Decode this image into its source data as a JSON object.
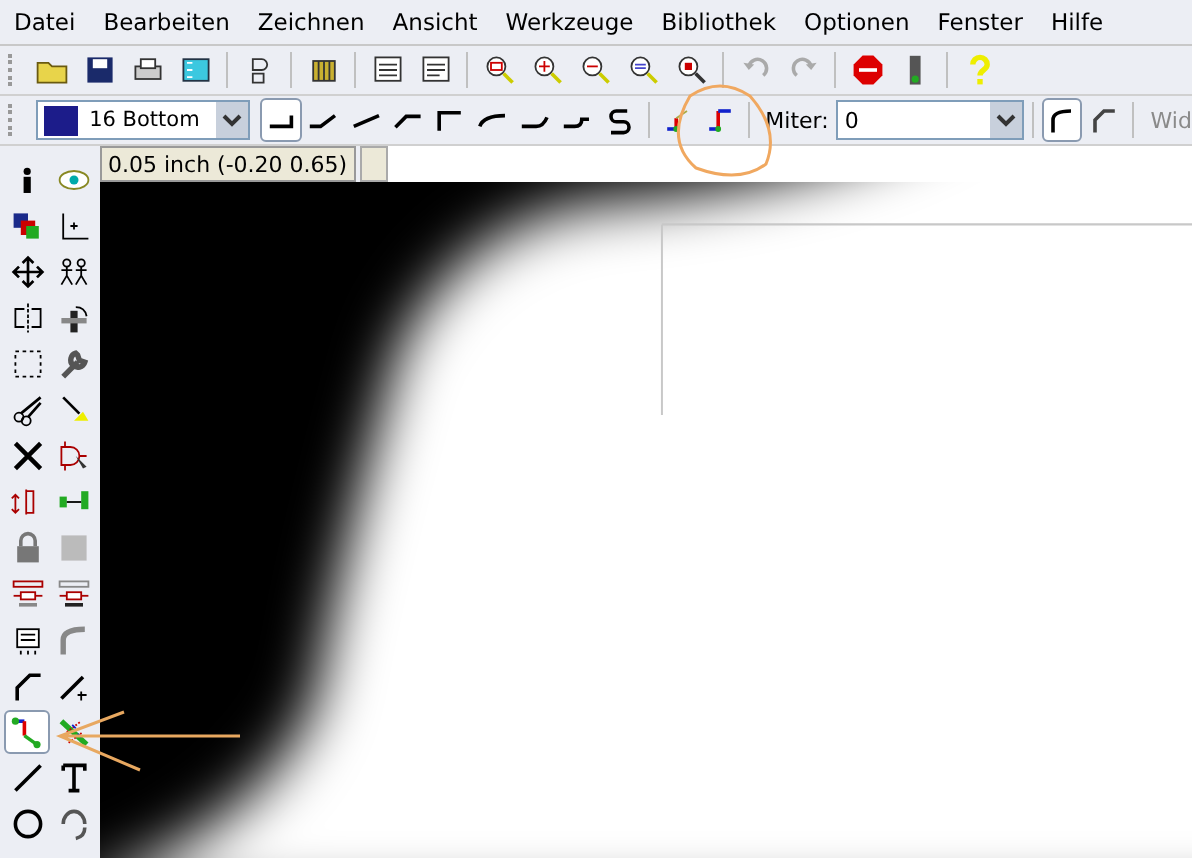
{
  "menu": [
    "Datei",
    "Bearbeiten",
    "Zeichnen",
    "Ansicht",
    "Werkzeuge",
    "Bibliothek",
    "Optionen",
    "Fenster",
    "Hilfe"
  ],
  "toolbar": [
    {
      "kind": "open"
    },
    {
      "kind": "save"
    },
    {
      "kind": "print"
    },
    {
      "kind": "cam"
    },
    {
      "kind": "sep"
    },
    {
      "kind": "schematic"
    },
    {
      "kind": "sep"
    },
    {
      "kind": "library"
    },
    {
      "kind": "sep"
    },
    {
      "kind": "script"
    },
    {
      "kind": "ulp"
    },
    {
      "kind": "sep"
    },
    {
      "kind": "zoomfit"
    },
    {
      "kind": "zoomin"
    },
    {
      "kind": "zoomout"
    },
    {
      "kind": "redraw"
    },
    {
      "kind": "zoomselect"
    },
    {
      "kind": "sep"
    },
    {
      "kind": "undo"
    },
    {
      "kind": "redo"
    },
    {
      "kind": "sep"
    },
    {
      "kind": "stop"
    },
    {
      "kind": "go"
    },
    {
      "kind": "sep"
    },
    {
      "kind": "help"
    }
  ],
  "params": {
    "layer": {
      "color": "#1c1c8a",
      "value": "16 Bottom"
    },
    "bends": [
      {
        "kind": "b0",
        "selected": true
      },
      {
        "kind": "b1",
        "selected": false
      },
      {
        "kind": "b2",
        "selected": false
      },
      {
        "kind": "b3",
        "selected": false
      },
      {
        "kind": "b4",
        "selected": false
      },
      {
        "kind": "b5",
        "selected": false
      },
      {
        "kind": "b6",
        "selected": false
      },
      {
        "kind": "b7",
        "selected": false
      },
      {
        "kind": "b8",
        "selected": false
      }
    ],
    "route_modes": [
      {
        "kind": "r1"
      },
      {
        "kind": "r2"
      }
    ],
    "miter_label": "Miter:",
    "miter_value": "0",
    "miter_styles": [
      {
        "kind": "round",
        "selected": true
      },
      {
        "kind": "straight",
        "selected": false
      }
    ],
    "width_label": "Wid"
  },
  "coordinates": "0.05 inch (-0.20 0.65)",
  "tools": [
    {
      "kind": "info",
      "selected": false
    },
    {
      "kind": "show",
      "selected": false
    },
    {
      "kind": "display",
      "selected": false
    },
    {
      "kind": "mark",
      "selected": false
    },
    {
      "kind": "move",
      "selected": false
    },
    {
      "kind": "copy",
      "selected": false
    },
    {
      "kind": "mirror",
      "selected": false
    },
    {
      "kind": "rotate",
      "selected": false
    },
    {
      "kind": "group",
      "selected": false
    },
    {
      "kind": "change",
      "selected": false
    },
    {
      "kind": "cut",
      "selected": false
    },
    {
      "kind": "paste",
      "selected": false
    },
    {
      "kind": "delete",
      "selected": false
    },
    {
      "kind": "add",
      "selected": false
    },
    {
      "kind": "replace",
      "selected": false
    },
    {
      "kind": "pinswap",
      "selected": false
    },
    {
      "kind": "lock",
      "selected": false
    },
    {
      "kind": "none",
      "selected": false
    },
    {
      "kind": "name",
      "selected": false
    },
    {
      "kind": "value",
      "selected": false
    },
    {
      "kind": "smash",
      "selected": false
    },
    {
      "kind": "miter",
      "selected": false
    },
    {
      "kind": "split",
      "selected": false
    },
    {
      "kind": "optimize",
      "selected": false
    },
    {
      "kind": "route",
      "selected": true
    },
    {
      "kind": "ripup",
      "selected": false
    },
    {
      "kind": "wire",
      "selected": false
    },
    {
      "kind": "text",
      "selected": false
    },
    {
      "kind": "circle",
      "selected": false
    },
    {
      "kind": "arc",
      "selected": false
    }
  ]
}
